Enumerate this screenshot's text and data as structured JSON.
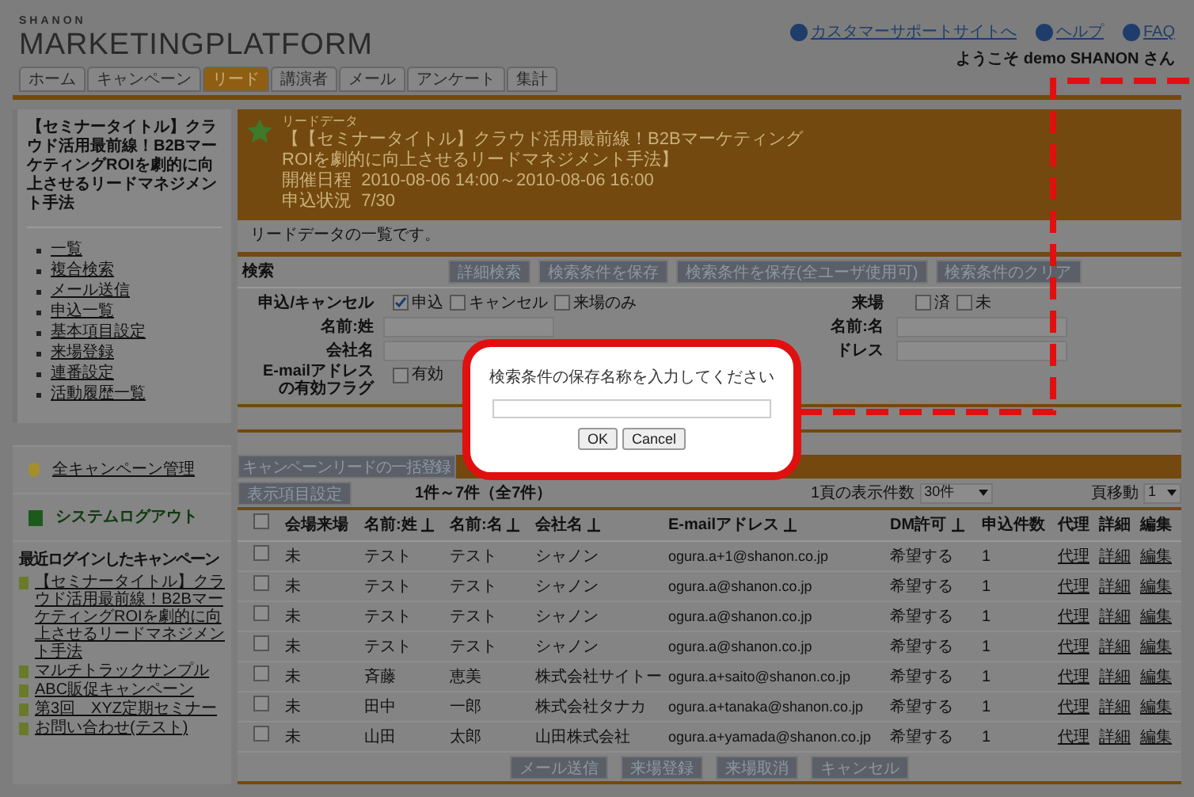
{
  "header": {
    "logo_small": "SHANON",
    "logo": "MARKETINGPLATFORM",
    "links": [
      "カスタマーサポートサイトへ",
      "ヘルプ",
      "FAQ"
    ],
    "welcome": "ようこそ demo SHANON さん"
  },
  "tabs": [
    {
      "label": "ホーム",
      "selected": false
    },
    {
      "label": "キャンペーン",
      "selected": false
    },
    {
      "label": "リード",
      "selected": true
    },
    {
      "label": "講演者",
      "selected": false
    },
    {
      "label": "メール",
      "selected": false
    },
    {
      "label": "アンケート",
      "selected": false
    },
    {
      "label": "集計",
      "selected": false
    }
  ],
  "sidebar": {
    "campaign_title": "【セミナータイトル】クラウド活用最前線！B2BマーケティングROIを劇的に向上させるリードマネジメント手法",
    "menu": [
      "一覧",
      "複合検索",
      "メール送信",
      "申込一覧",
      "基本項目設定",
      "来場登録",
      "連番設定",
      "活動履歴一覧"
    ],
    "links": [
      {
        "kind": "manage",
        "label": "全キャンペーン管理"
      },
      {
        "kind": "logout",
        "label": "システムログアウト"
      }
    ],
    "recent_title": "最近ログインしたキャンペーン",
    "recent": [
      "【セミナータイトル】クラウド活用最前線！B2BマーケティングROIを劇的に向上させるリードマネジメント手法",
      "マルチトラックサンプル",
      "ABC販促キャンペーン",
      "第3回　XYZ定期セミナー",
      "お問い合わせ(テスト)"
    ]
  },
  "main": {
    "section_label": "リードデータ",
    "title_lines": [
      "【【セミナータイトル】クラウド活用最前線！B2Bマーケティング",
      "ROIを劇的に向上させるリードマネジメント手法】",
      "開催日程  2010-08-06 14:00～2010-08-06 16:00",
      "申込状況  7/30"
    ],
    "description": "リードデータの一覧です。",
    "search": {
      "title": "検索",
      "buttons": [
        "詳細検索",
        "検索条件を保存",
        "検索条件を保存(全ユーザ使用可)",
        "検索条件のクリア"
      ],
      "apply_label": "申込/キャンセル",
      "apply_options": [
        {
          "label": "申込",
          "checked": true
        },
        {
          "label": "キャンセル",
          "checked": false
        },
        {
          "label": "来場のみ",
          "checked": false
        }
      ],
      "visit_label": "来場",
      "visit_options": [
        {
          "label": "済",
          "checked": false
        },
        {
          "label": "未",
          "checked": false
        }
      ],
      "last_name_label": "名前:姓",
      "first_name_label": "名前:名",
      "company_label": "会社名",
      "email_label": "ドレス",
      "email_flag_label_lines": [
        "E-mailアドレス",
        "の有効フラグ"
      ],
      "email_flag_options": [
        {
          "label": "有効",
          "checked": false
        }
      ]
    },
    "bulk_button": "キャンペーンリードの一括登録",
    "columns_button": "表示項目設定",
    "count": "1件～7件（全7件）",
    "per_page_label": "1頁の表示件数",
    "per_page": "30件",
    "page_label": "頁移動",
    "page": "1",
    "table": {
      "select_all_checked": false,
      "columns": [
        {
          "label": "会場来場",
          "sortable": false
        },
        {
          "label": "名前:姓",
          "sortable": true
        },
        {
          "label": "名前:名",
          "sortable": true
        },
        {
          "label": "会社名",
          "sortable": true
        },
        {
          "label": "E-mailアドレス",
          "sortable": true
        },
        {
          "label": "DM許可",
          "sortable": true
        },
        {
          "label": "申込件数",
          "sortable": false
        },
        {
          "label": "代理",
          "sortable": false
        },
        {
          "label": "詳細",
          "sortable": false
        },
        {
          "label": "編集",
          "sortable": false
        }
      ],
      "rows": [
        {
          "checked": false,
          "cells": [
            "未",
            "テスト",
            "テスト",
            "シャノン",
            "ogura.a+1@shanon.co.jp",
            "希望する",
            "1"
          ],
          "links": [
            "代理",
            "詳細",
            "編集"
          ]
        },
        {
          "checked": false,
          "cells": [
            "未",
            "テスト",
            "テスト",
            "シャノン",
            "ogura.a@shanon.co.jp",
            "希望する",
            "1"
          ],
          "links": [
            "代理",
            "詳細",
            "編集"
          ]
        },
        {
          "checked": false,
          "cells": [
            "未",
            "テスト",
            "テスト",
            "シャノン",
            "ogura.a@shanon.co.jp",
            "希望する",
            "1"
          ],
          "links": [
            "代理",
            "詳細",
            "編集"
          ]
        },
        {
          "checked": false,
          "cells": [
            "未",
            "テスト",
            "テスト",
            "シャノン",
            "ogura.a@shanon.co.jp",
            "希望する",
            "1"
          ],
          "links": [
            "代理",
            "詳細",
            "編集"
          ]
        },
        {
          "checked": false,
          "cells": [
            "未",
            "斉藤",
            "恵美",
            "株式会社サイトー",
            "ogura.a+saito@shanon.co.jp",
            "希望する",
            "1"
          ],
          "links": [
            "代理",
            "詳細",
            "編集"
          ]
        },
        {
          "checked": false,
          "cells": [
            "未",
            "田中",
            "一郎",
            "株式会社タナカ",
            "ogura.a+tanaka@shanon.co.jp",
            "希望する",
            "1"
          ],
          "links": [
            "代理",
            "詳細",
            "編集"
          ]
        },
        {
          "checked": false,
          "cells": [
            "未",
            "山田",
            "太郎",
            "山田株式会社",
            "ogura.a+yamada@shanon.co.jp",
            "希望する",
            "1"
          ],
          "links": [
            "代理",
            "詳細",
            "編集"
          ]
        }
      ]
    },
    "bottom_buttons": [
      "メール送信",
      "来場登録",
      "来場取消",
      "キャンセル"
    ]
  },
  "dialog": {
    "prompt": "検索条件の保存名称を入力してください",
    "buttons": [
      "OK",
      "Cancel"
    ]
  }
}
